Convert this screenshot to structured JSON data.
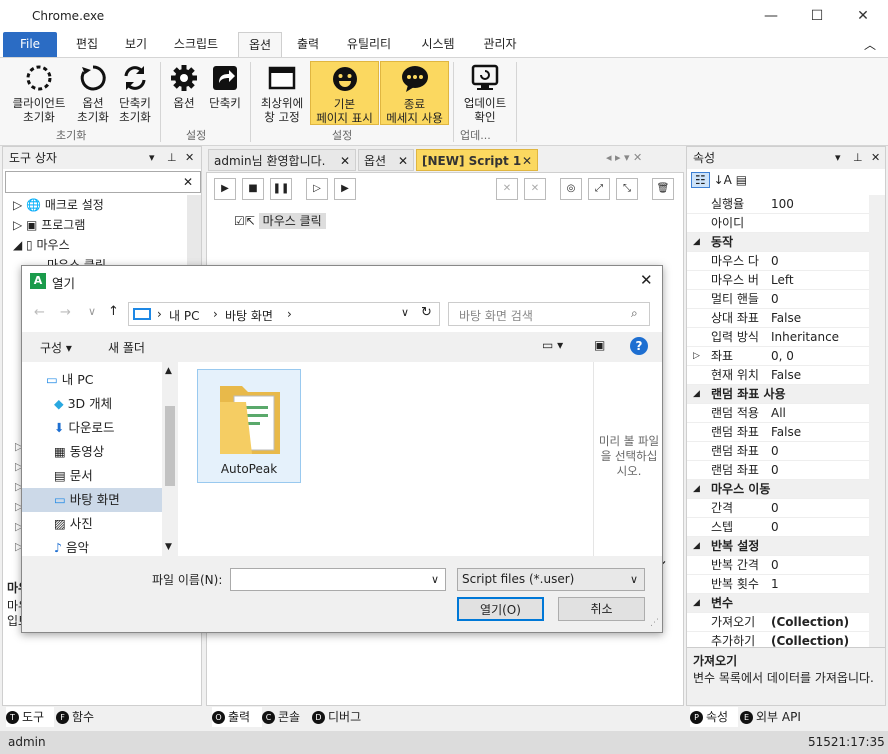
{
  "window": {
    "title": "Chrome.exe"
  },
  "menu": {
    "tabs": [
      "File",
      "편집",
      "보기",
      "스크립트",
      "옵션",
      "출력",
      "유틸리티",
      "시스템",
      "관리자"
    ]
  },
  "ribbon": {
    "buttons": [
      {
        "l1": "클라이언트",
        "l2": "초기화"
      },
      {
        "l1": "옵션",
        "l2": "초기화"
      },
      {
        "l1": "단축키",
        "l2": "초기화"
      },
      {
        "l1": "옵션",
        "l2": ""
      },
      {
        "l1": "단축키",
        "l2": ""
      },
      {
        "l1": "최상위에",
        "l2": "창 고정"
      },
      {
        "l1": "기본",
        "l2": "페이지 표시"
      },
      {
        "l1": "종료",
        "l2": "메세지 사용"
      },
      {
        "l1": "업데이트",
        "l2": "확인"
      }
    ],
    "groups": [
      "초기화",
      "설정",
      "설정",
      "업데..."
    ]
  },
  "toolbox": {
    "title": "도구 상자",
    "items": [
      "매크로 설정",
      "프로그램",
      "마우스",
      "마우스 클릭"
    ],
    "section": "마우",
    "desc1": "마우",
    "desc2": "입트"
  },
  "docs": {
    "tabs": [
      "admin님 환영합니다.",
      "옵션",
      "[NEW] Script 1"
    ],
    "node": "마우스 클릭"
  },
  "props": {
    "title": "속성",
    "rows": [
      {
        "k": "실행율",
        "v": "100"
      },
      {
        "k": "아이디",
        "v": ""
      },
      {
        "cat": "동작"
      },
      {
        "k": "마우스 다",
        "v": "0"
      },
      {
        "k": "마우스 버",
        "v": "Left"
      },
      {
        "k": "멀티 핸들",
        "v": "0"
      },
      {
        "k": "상대 좌표",
        "v": "False"
      },
      {
        "k": "입력 방식",
        "v": "Inheritance"
      },
      {
        "k": "좌표",
        "v": "0, 0",
        "exp": true
      },
      {
        "k": "현재 위치",
        "v": "False"
      },
      {
        "cat": "랜덤 좌표 사용"
      },
      {
        "k": "랜덤 적용",
        "v": "All"
      },
      {
        "k": "랜덤 좌표",
        "v": "False"
      },
      {
        "k": "랜덤 좌표",
        "v": "0"
      },
      {
        "k": "랜덤 좌표",
        "v": "0"
      },
      {
        "cat": "마우스 이동"
      },
      {
        "k": "간격",
        "v": "0"
      },
      {
        "k": "스텝",
        "v": "0"
      },
      {
        "cat": "반복 설정"
      },
      {
        "k": "반복 간격",
        "v": "0"
      },
      {
        "k": "반복 횟수",
        "v": "1"
      },
      {
        "cat": "변수"
      },
      {
        "k": "가져오기",
        "v": "(Collection)"
      },
      {
        "k": "추가하기",
        "v": "(Collection)"
      }
    ],
    "help_title": "가져오기",
    "help_text": "변수 목록에서 데이터를 가져옵니다."
  },
  "bottom_tabs": {
    "left": [
      "도구",
      "함수"
    ],
    "mid": [
      "출력",
      "콘솔",
      "디버그"
    ],
    "right": [
      "속성",
      "외부 API"
    ]
  },
  "status": {
    "user": "admin",
    "time": "51521:17:35"
  },
  "dialog": {
    "title": "열기",
    "path": [
      "내 PC",
      "바탕 화면"
    ],
    "search_placeholder": "바탕 화면 검색",
    "organize": "구성",
    "new_folder": "새 폴더",
    "nav": [
      "내 PC",
      "3D 개체",
      "다운로드",
      "동영상",
      "문서",
      "바탕 화면",
      "사진",
      "음악"
    ],
    "file": "AutoPeak",
    "preview": "미리 볼 파일을 선택하십시오.",
    "filename_label": "파일 이름(N):",
    "filter": "Script files (*.user)",
    "open": "열기(O)",
    "cancel": "취소"
  }
}
